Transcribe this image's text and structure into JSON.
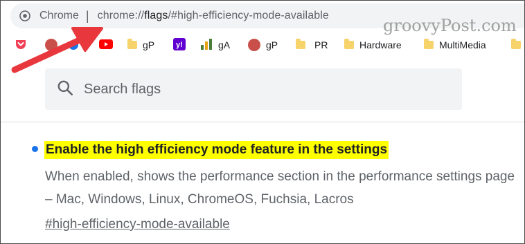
{
  "omnibox": {
    "chip_label": "Chrome",
    "separator": "|",
    "url_scheme": "chrome://",
    "url_host": "flags",
    "url_rest": "/#high-efficiency-mode-available",
    "site_icon": "chrome-info-icon"
  },
  "watermark": "groovyPost.com",
  "bookmarks": [
    {
      "icon": "pocket-icon",
      "label": ""
    },
    {
      "icon": "groovypost-icon",
      "label": ""
    },
    {
      "icon": "youtube-icon",
      "label": ""
    },
    {
      "icon": "folder-icon",
      "label": "gP"
    },
    {
      "icon": "yahoo-icon",
      "label": ""
    },
    {
      "icon": "analytics-icon",
      "label": "gA"
    },
    {
      "icon": "groovypost-icon",
      "label": "gP"
    },
    {
      "icon": "folder-icon",
      "label": "PR"
    },
    {
      "icon": "folder-icon",
      "label": "Hardware"
    },
    {
      "icon": "folder-icon",
      "label": "MultiMedia"
    }
  ],
  "search": {
    "placeholder": "Search flags",
    "value": ""
  },
  "flag": {
    "title": "Enable the high efficiency mode feature in the settings",
    "description": "When enabled, shows the performance section in the performance settings page – Mac, Windows, Linux, ChromeOS, Fuchsia, Lacros",
    "link": "#high-efficiency-mode-available"
  },
  "colors": {
    "highlight": "#ffff00",
    "bullet": "#1a73e8",
    "arrow": "#e8383d"
  }
}
